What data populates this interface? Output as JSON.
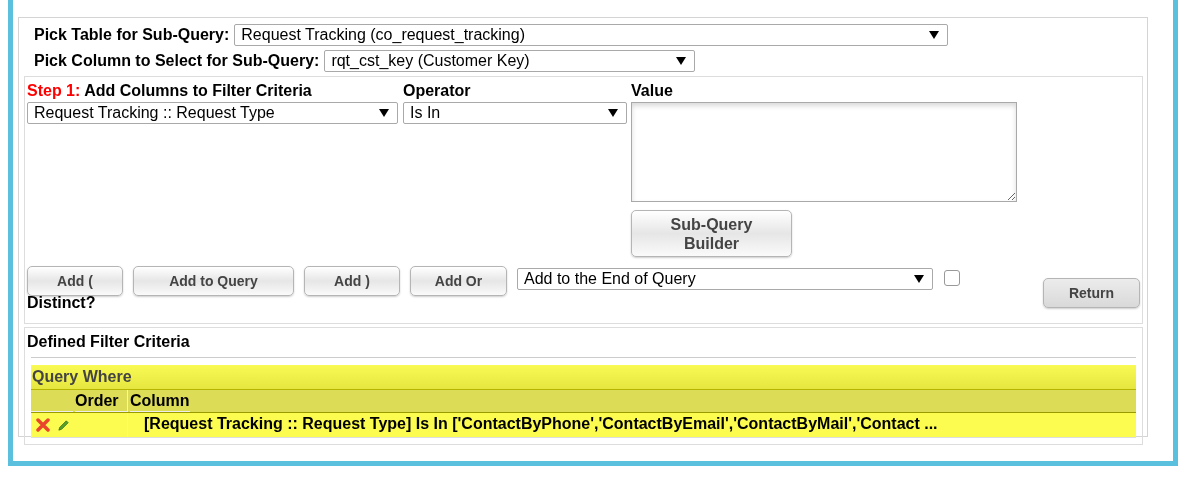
{
  "sub_query": {
    "table_label": "Pick Table for Sub-Query:",
    "table_value": "Request Tracking (co_request_tracking)",
    "column_label": "Pick Column to Select for Sub-Query:",
    "column_value": "rqt_cst_key (Customer Key)"
  },
  "step": {
    "step_label": "Step 1:",
    "title": "Add Columns to Filter Criteria",
    "operator_label": "Operator",
    "value_label": "Value",
    "column_value": "Request Tracking :: Request Type",
    "operator_value": "Is In",
    "builder_button": "Sub-Query Builder"
  },
  "actions": {
    "buttons": [
      "Add (",
      "Add to Query",
      "Add )",
      "Add Or"
    ],
    "position_value": "Add to the End of Query",
    "distinct": {
      "checked": false,
      "label": "Distinct?"
    },
    "return_button": "Return"
  },
  "criteria": {
    "title": "Defined Filter Criteria",
    "group_title": "Query Where",
    "columns": [
      "Order",
      "Column"
    ],
    "rows": [
      {
        "order": "",
        "column": "[Request Tracking :: Request Type] Is In ['ContactByPhone','ContactByEmail','ContactByMail','Contact ..."
      }
    ]
  }
}
